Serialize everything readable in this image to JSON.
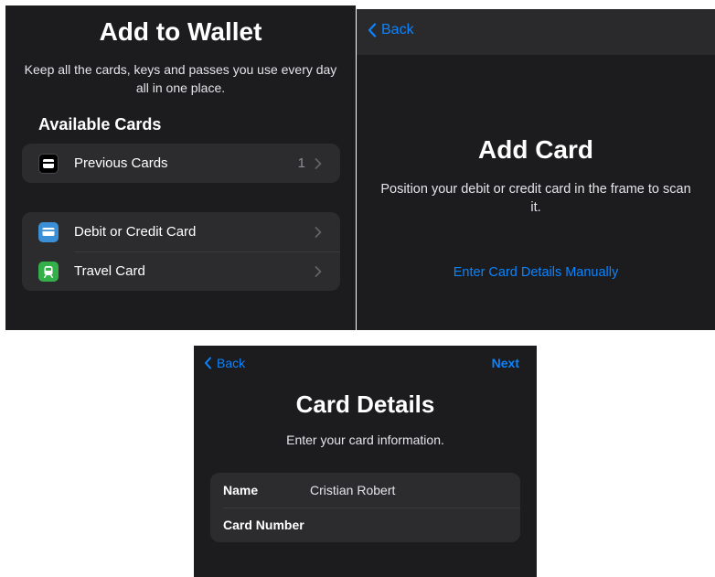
{
  "wallet": {
    "title": "Add to Wallet",
    "subtitle": "Keep all the cards, keys and passes you use every day all in one place.",
    "section_title": "Available Cards",
    "previous_cards": {
      "label": "Previous Cards",
      "count": "1",
      "icon": "wallet-icon"
    },
    "card_types": [
      {
        "label": "Debit or Credit Card",
        "icon": "credit-card-icon",
        "color": "#3a8fd6"
      },
      {
        "label": "Travel Card",
        "icon": "train-icon",
        "color": "#33b04a"
      }
    ]
  },
  "add_card": {
    "back_label": "Back",
    "title": "Add Card",
    "subtitle": "Position your debit or credit card in the frame to scan it.",
    "manual_link": "Enter Card Details Manually"
  },
  "card_details": {
    "back_label": "Back",
    "next_label": "Next",
    "title": "Card Details",
    "subtitle": "Enter your card information.",
    "fields": [
      {
        "label": "Name",
        "value": "Cristian Robert"
      },
      {
        "label": "Card Number",
        "value": ""
      }
    ]
  },
  "colors": {
    "background": "#1c1c1e",
    "cell": "#2c2c2e",
    "accent_blue": "#0a84ff"
  }
}
